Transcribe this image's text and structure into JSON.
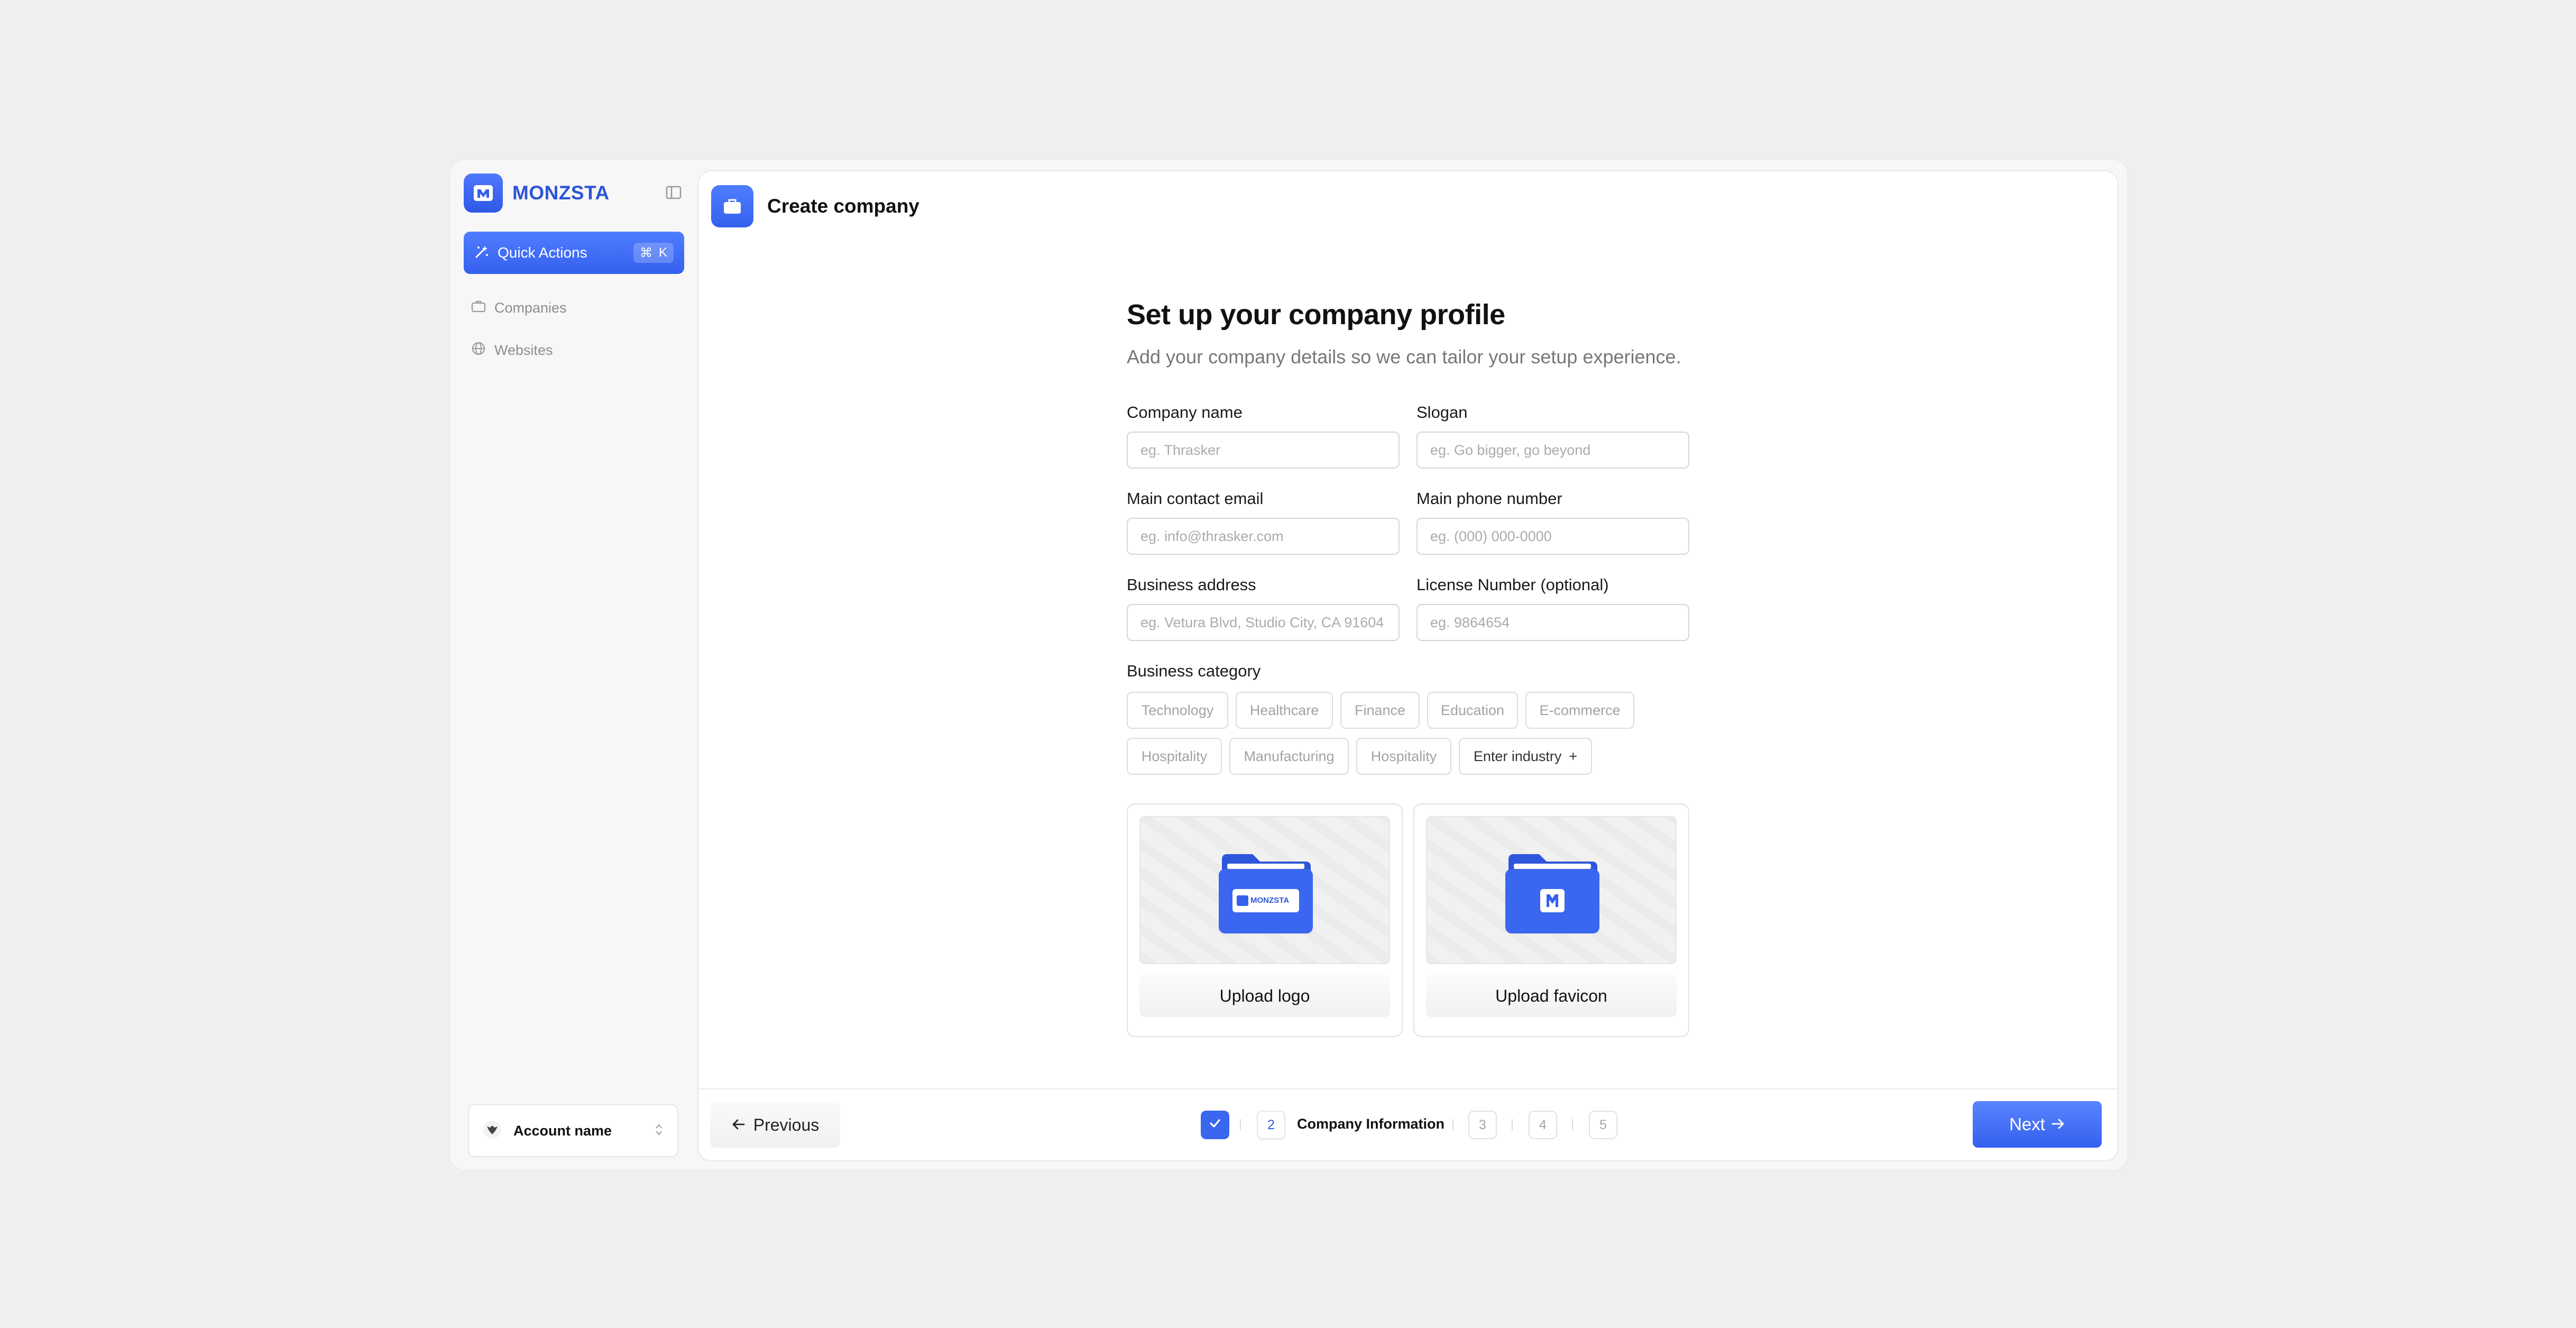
{
  "sidebar": {
    "brand": "MONZSTA",
    "quick_actions": {
      "label": "Quick Actions",
      "shortcut_symbol": "⌘",
      "shortcut_key": "K"
    },
    "nav": [
      {
        "label": "Companies",
        "icon": "briefcase-icon"
      },
      {
        "label": "Websites",
        "icon": "globe-icon"
      }
    ],
    "account": {
      "name": "Account name"
    }
  },
  "header": {
    "title": "Create company"
  },
  "form": {
    "heading": "Set up your company profile",
    "subheading": "Add your company details so we can tailor your setup experience.",
    "fields": {
      "company_name": {
        "label": "Company name",
        "placeholder": "eg. Thrasker",
        "value": ""
      },
      "slogan": {
        "label": "Slogan",
        "placeholder": "eg. Go bigger, go beyond",
        "value": ""
      },
      "email": {
        "label": "Main contact email",
        "placeholder": "eg. info@thrasker.com",
        "value": ""
      },
      "phone": {
        "label": "Main phone number",
        "placeholder": "eg. (000) 000-0000",
        "value": ""
      },
      "address": {
        "label": "Business address",
        "placeholder": "eg. Vetura Blvd, Studio City, CA 91604",
        "value": ""
      },
      "license": {
        "label": "License Number (optional)",
        "placeholder": "eg. 9864654",
        "value": ""
      }
    },
    "category": {
      "label": "Business category",
      "chips": [
        "Technology",
        "Healthcare",
        "Finance",
        "Education",
        "E-commerce",
        "Hospitality",
        "Manufacturing",
        "Hospitality"
      ],
      "enter_label": "Enter industry",
      "enter_symbol": "+"
    },
    "uploads": {
      "logo": {
        "label": "Upload logo",
        "badge_text": "MONZSTA"
      },
      "favicon": {
        "label": "Upload favicon"
      }
    }
  },
  "footer": {
    "previous_label": "Previous",
    "next_label": "Next",
    "steps": [
      {
        "number": "1",
        "state": "done"
      },
      {
        "number": "2",
        "state": "active",
        "label": "Company Information"
      },
      {
        "number": "3",
        "state": "pending"
      },
      {
        "number": "4",
        "state": "pending"
      },
      {
        "number": "5",
        "state": "pending"
      }
    ]
  },
  "colors": {
    "accent": "#3560ee",
    "brand_text": "#2a55d8",
    "muted": "#8d8d8d",
    "background": "#efefef"
  }
}
